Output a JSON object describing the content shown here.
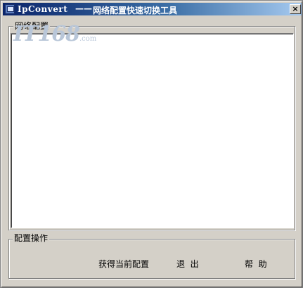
{
  "window": {
    "title_en": "IpConvert",
    "title_sep": "——",
    "title_cn": "网络配置快速切换工具",
    "close_glyph": "×"
  },
  "network_group": {
    "label": "网络配置"
  },
  "watermark": {
    "text": "IT168",
    "suffix": ".com"
  },
  "ops_group": {
    "label": "配置操作",
    "buttons": {
      "get_config": "获得当前配置",
      "exit": "退  出",
      "help": "帮  助"
    }
  },
  "colors": {
    "face": "#d4d0c8",
    "titlebar_start": "#0a246a",
    "titlebar_end": "#a6caf0"
  }
}
